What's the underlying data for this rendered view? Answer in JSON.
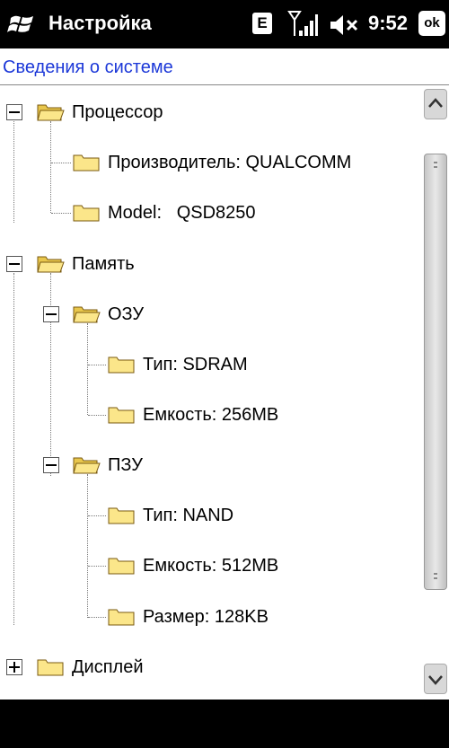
{
  "status_bar": {
    "title": "Настройка",
    "e_badge": "E",
    "time": "9:52",
    "ok_label": "ok",
    "icons": [
      "windows-flag-icon",
      "signal-strength-icon",
      "volume-muted-icon"
    ]
  },
  "page": {
    "heading": "Сведения о системе",
    "heading_color": "#1c38d8"
  },
  "tree": {
    "processor": {
      "label": "Процессор",
      "expanded": true,
      "children": {
        "manufacturer": "Производитель: QUALCOMM",
        "model": "Model:   QSD8250"
      }
    },
    "memory": {
      "label": "Память",
      "expanded": true,
      "ram": {
        "label": "ОЗУ",
        "expanded": true,
        "type": "Тип: SDRAM",
        "capacity": "Емкость: 256MB"
      },
      "rom": {
        "label": "ПЗУ",
        "expanded": true,
        "type": "Тип: NAND",
        "capacity": "Емкость: 512MB",
        "size": "Размер: 128KB"
      }
    },
    "display": {
      "label": "Дисплей",
      "expanded": false
    }
  }
}
